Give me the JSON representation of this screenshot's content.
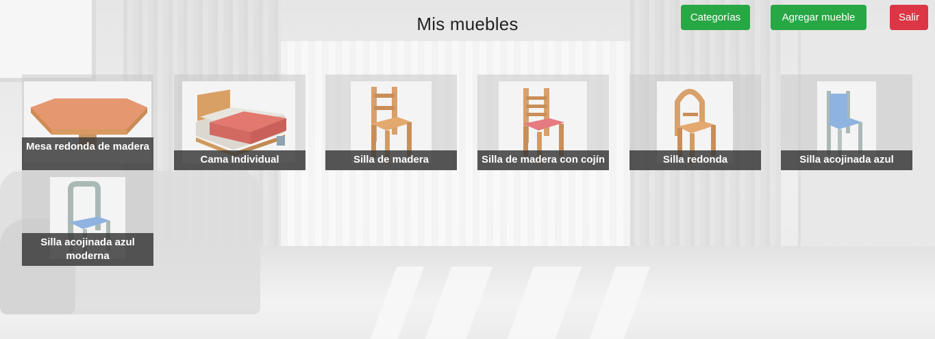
{
  "header": {
    "title": "Mis muebles",
    "categories_label": "Categorías",
    "add_label": "Agregar mueble",
    "exit_label": "Salir"
  },
  "colors": {
    "success": "#28a745",
    "danger": "#dc3545",
    "caption_bg": "#3c3c3c"
  },
  "items": [
    {
      "name": "Mesa redonda de madera",
      "icon": "table-icon"
    },
    {
      "name": "Cama Individual",
      "icon": "bed-icon"
    },
    {
      "name": "Silla de madera",
      "icon": "chair-icon"
    },
    {
      "name": "Silla de madera con cojín",
      "icon": "cushion-chair-icon"
    },
    {
      "name": "Silla redonda",
      "icon": "round-chair-icon"
    },
    {
      "name": "Silla acojinada azul",
      "icon": "blue-chair-icon"
    },
    {
      "name": "Silla acojinada azul moderna",
      "icon": "modern-blue-chair-icon"
    }
  ]
}
